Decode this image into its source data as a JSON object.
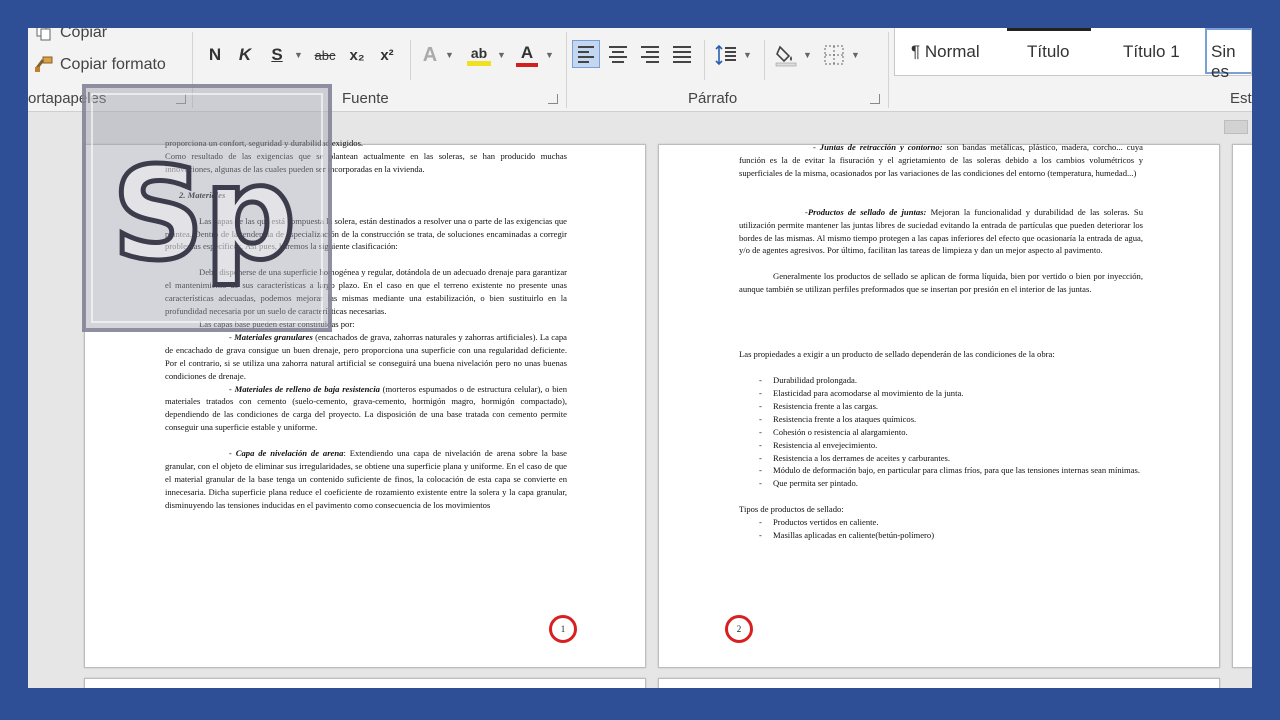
{
  "ribbon": {
    "clipboard": {
      "copy_label": "Copiar",
      "format_painter_label": "Copiar formato",
      "group_label": "ortapapeles"
    },
    "font": {
      "group_label": "Fuente",
      "bold": "N",
      "italic": "K",
      "underline": "S",
      "strikethrough": "abc",
      "subscript": "x₂",
      "superscript": "x²",
      "text_effects": "A",
      "highlight": "ab",
      "font_color": "A",
      "highlight_color": "#f0e020",
      "font_color_bar": "#d02020"
    },
    "paragraph": {
      "group_label": "Párrafo"
    },
    "styles": {
      "group_label": "Est",
      "items": [
        "¶ Normal",
        "Título",
        "Título 1",
        "Sin es"
      ]
    }
  },
  "logo": {
    "text": "Sp"
  },
  "pages": {
    "left": {
      "number": "1",
      "text_top": [
        "proporciona un confort, seguridad y durabilidad exigidos.",
        "Como resultado de las exigencias que se plantean actualmente en las soleras, se han producido muchas innovaciones, algunas de las cuales pueden ser incorporadas en la vivienda."
      ],
      "heading": "2.    Materiales",
      "text_mid": "Las capas de las que está compuesta la solera, están destinados a resolver una o parte de las exigencias que plantea. Dentro de la tendencia de especialización de la construcción se trata, de soluciones encaminadas a corregir problemas específicos. Así pues, haremos la siguiente clasificación:",
      "para_base": "Debe disponerse de una superficie homogénea y regular, dotándola de un adecuado drenaje para garantizar el mantenimiento de sus características a largo plazo. En el caso en que el terreno existente no presente unas características adecuadas, podemos mejorar las mismas mediante una estabilización, o bien sustituirlo en la profundidad necesaria por un suelo de características necesarias.",
      "capas_intro": "Las capas base pueden estar constituidas por:",
      "mat_gran_title": "- Materiales granulares",
      "mat_gran_text": " (encachados de grava, zahorras naturales y zahorras artificiales). La capa de encachado de grava consigue un buen drenaje, pero proporciona una superficie con una regularidad deficiente. Por el contrario, si se utiliza una zahorra natural artificial se conseguirá una buena nivelación pero no unas buenas condiciones de drenaje.",
      "mat_rell_title": "- Materiales de relleno de baja resistencia",
      "mat_rell_text": " (morteros espumados o de estructura celular), o bien materiales tratados con cemento (suelo-cemento, grava-cemento, hormigón magro, hormigón compactado), dependiendo de las condiciones de carga del proyecto. La disposición de una base tratada con cemento permite conseguir una superficie estable y uniforme.",
      "capa_niv_title": "- Capa de nivelación de arena",
      "capa_niv_text": ": Extendiendo una capa de nivelación de arena sobre la base granular, con el objeto de eliminar sus irregularidades, se obtiene una superficie plana y uniforme. En el caso de que el material granular de la base tenga un contenido suficiente de finos, la colocación de esta capa se convierte en innecesaria. Dicha superficie plana reduce el coeficiente de rozamiento existente entre la solera y la capa granular, disminuyendo las tensiones inducidas en el pavimento como consecuencia de los movimientos"
    },
    "right": {
      "number": "2",
      "juntas_title": "- Juntas de retracción y contorno:",
      "juntas_text": " son bandas metálicas, plástico, madera, corcho... cuya función es la de evitar la fisuración y el agrietamiento de las soleras debido a los cambios volumétricos y superficiales de la misma, ocasionados por las variaciones de las condiciones del entorno (temperatura, humedad...)",
      "prod_title": "-Productos de sellado de juntas:",
      "prod_text": " Mejoran la funcionalidad y durabilidad de las soleras. Su utilización permite mantener las juntas libres de suciedad evitando la entrada de partículas que pueden deteriorar los bordes de las mismas. Al mismo tiempo protegen a las capas inferiores del efecto que ocasionaría la entrada de agua, y/o de agentes agresivos. Por último, facilitan las tareas de limpieza y dan un mejor aspecto al pavimento.",
      "general": "Generalmente los productos de sellado se aplican de forma líquida, bien por vertido o bien por inyección, aunque también se utilizan perfiles preformados que se insertan por presión en el interior de las juntas.",
      "props_intro": "Las propiedades a exigir a un producto de sellado dependerán de las condiciones de la obra:",
      "props": [
        "Durabilidad prolongada.",
        "Elasticidad para acomodarse al movimiento de la junta.",
        "Resistencia frente a las cargas.",
        "Resistencia frente a los ataques químicos.",
        "Cohesión o resistencia al alargamiento.",
        "Resistencia al envejecimiento.",
        "Resistencia a los derrames de aceites y carburantes.",
        "Módulo de deformación bajo, en particular para climas fríos, para que las tensiones internas sean mínimas.",
        "Que permita ser pintado."
      ],
      "tipos_intro": "Tipos de productos de sellado:",
      "tipos": [
        "Productos vertidos en caliente.",
        "Masillas aplicadas en caliente(betún-polímero)"
      ]
    }
  }
}
